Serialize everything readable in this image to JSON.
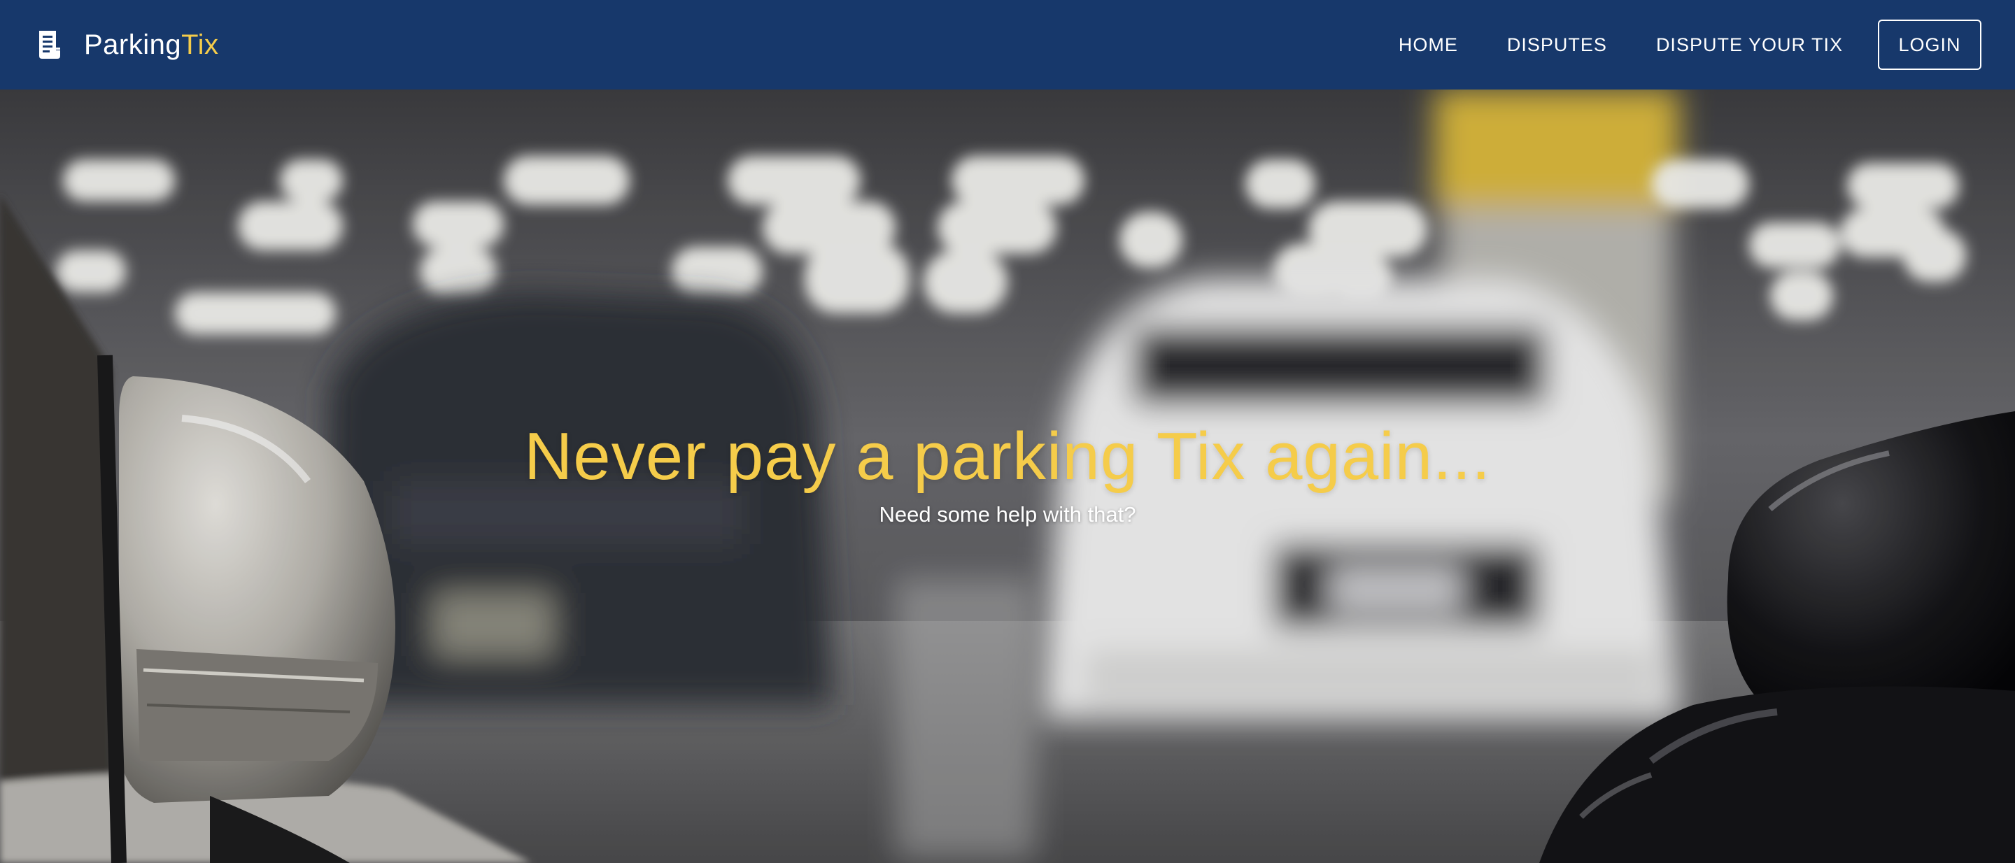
{
  "brand": {
    "icon": "receipt-icon",
    "name_primary": "Parking",
    "name_accent": "Tix"
  },
  "nav": {
    "links": [
      {
        "label": "HOME"
      },
      {
        "label": "DISPUTES"
      },
      {
        "label": "DISPUTE YOUR TIX"
      }
    ],
    "login_label": "LOGIN"
  },
  "hero": {
    "title": "Never pay a parking Tix again...",
    "subtitle": "Need some help with that?",
    "background": "blurred-parking-garage-photo"
  },
  "colors": {
    "navbar": "#17386b",
    "accent": "#f5cc4a",
    "text_light": "#ffffff"
  }
}
